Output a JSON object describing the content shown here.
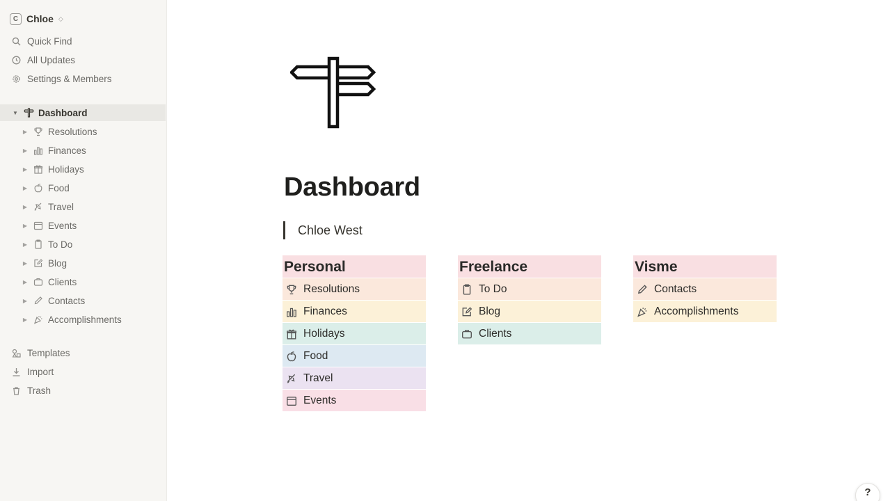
{
  "sidebar": {
    "workspace": {
      "name": "Chloe",
      "badge": "C",
      "caret": "◇"
    },
    "top_items": [
      {
        "label": "Quick Find",
        "icon": "search-icon"
      },
      {
        "label": "All Updates",
        "icon": "clock-icon"
      },
      {
        "label": "Settings & Members",
        "icon": "gear-icon"
      }
    ],
    "pages": [
      {
        "label": "Dashboard",
        "icon": "signpost-icon",
        "active": true
      },
      {
        "label": "Resolutions",
        "icon": "trophy-icon"
      },
      {
        "label": "Finances",
        "icon": "bar-chart-icon"
      },
      {
        "label": "Holidays",
        "icon": "gift-icon"
      },
      {
        "label": "Food",
        "icon": "apple-icon"
      },
      {
        "label": "Travel",
        "icon": "plane-icon"
      },
      {
        "label": "Events",
        "icon": "calendar-icon"
      },
      {
        "label": "To Do",
        "icon": "clipboard-icon"
      },
      {
        "label": "Blog",
        "icon": "edit-icon"
      },
      {
        "label": "Clients",
        "icon": "briefcase-icon"
      },
      {
        "label": "Contacts",
        "icon": "pencil-icon"
      },
      {
        "label": "Accomplishments",
        "icon": "party-icon"
      }
    ],
    "bottom_items": [
      {
        "label": "Templates",
        "icon": "shapes-icon"
      },
      {
        "label": "Import",
        "icon": "import-icon"
      },
      {
        "label": "Trash",
        "icon": "trash-icon"
      }
    ]
  },
  "main": {
    "title": "Dashboard",
    "quote": "Chloe West",
    "columns": [
      {
        "heading": "Personal",
        "items": [
          {
            "label": "Resolutions",
            "icon": "trophy-icon",
            "color": "#fbe8dc"
          },
          {
            "label": "Finances",
            "icon": "bar-chart-icon",
            "color": "#fcf1d8"
          },
          {
            "label": "Holidays",
            "icon": "gift-icon",
            "color": "#dbeee9"
          },
          {
            "label": "Food",
            "icon": "apple-icon",
            "color": "#dde9f2"
          },
          {
            "label": "Travel",
            "icon": "plane-icon",
            "color": "#ebe2f1"
          },
          {
            "label": "Events",
            "icon": "calendar-icon",
            "color": "#f9dfe6"
          }
        ]
      },
      {
        "heading": "Freelance",
        "items": [
          {
            "label": "To Do",
            "icon": "clipboard-icon",
            "color": "#fbe8dc"
          },
          {
            "label": "Blog",
            "icon": "edit-icon",
            "color": "#fcf1d8"
          },
          {
            "label": "Clients",
            "icon": "briefcase-icon",
            "color": "#dbeee9"
          }
        ]
      },
      {
        "heading": "Visme",
        "items": [
          {
            "label": "Contacts",
            "icon": "pencil-icon",
            "color": "#fbe8dc"
          },
          {
            "label": "Accomplishments",
            "icon": "party-icon",
            "color": "#fcf1d8"
          }
        ]
      }
    ],
    "help_label": "?"
  },
  "colors": {
    "sidebar_bg": "#f7f6f3",
    "heading_bg": "#f9dfe2",
    "active_row": "#e9e8e4"
  }
}
